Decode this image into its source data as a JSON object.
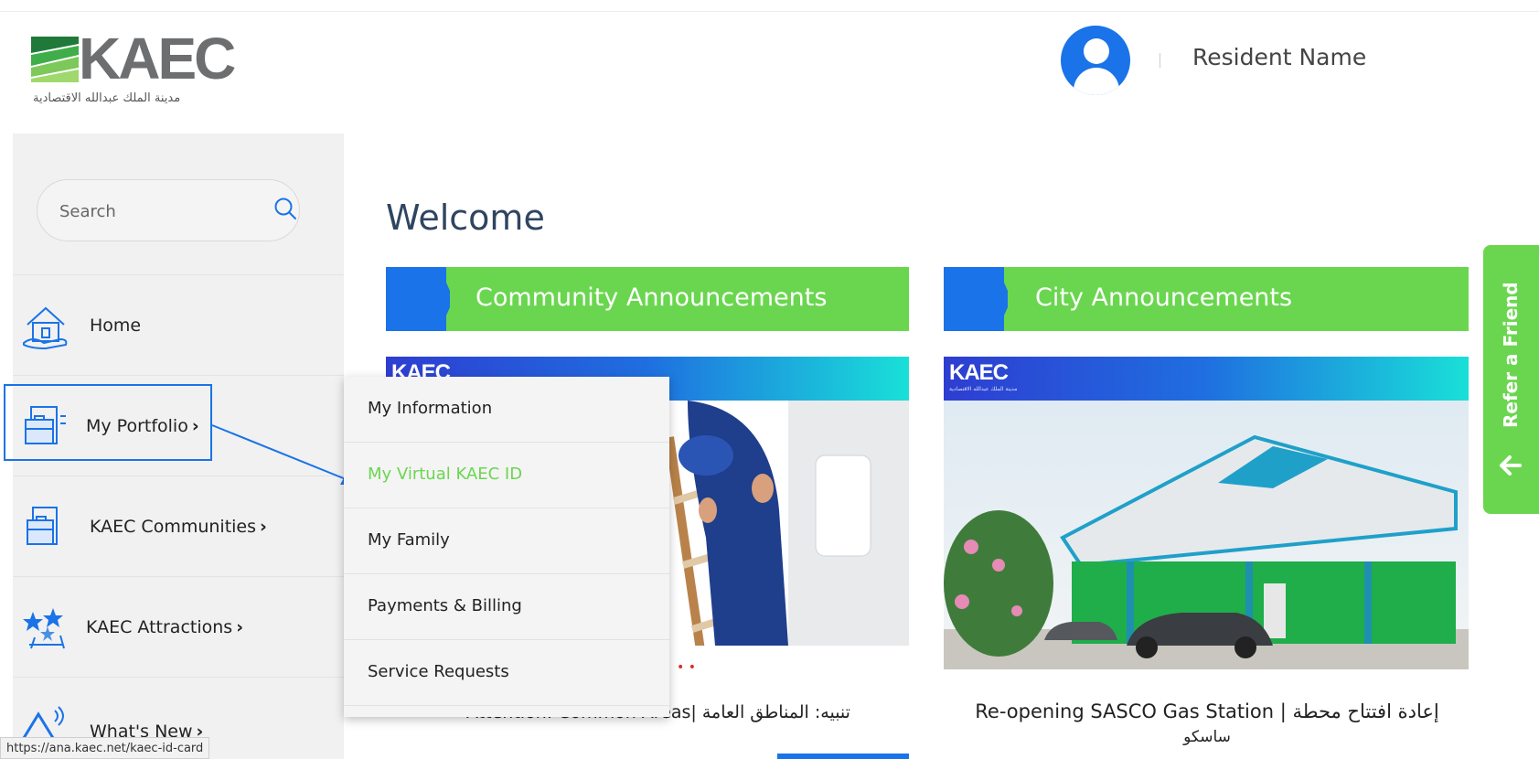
{
  "header": {
    "logo_text": "KAEC",
    "logo_arabic": "مدينة الملك عبدالله الاقتصادية",
    "resident_name": "Resident Name"
  },
  "sidebar": {
    "search_placeholder": "Search",
    "items": [
      {
        "label": "Home",
        "has_chevron": false,
        "icon": "home-icon"
      },
      {
        "label": "My Portfolio",
        "has_chevron": true,
        "icon": "portfolio-icon"
      },
      {
        "label": "KAEC Communities",
        "has_chevron": true,
        "icon": "communities-icon"
      },
      {
        "label": "KAEC Attractions",
        "has_chevron": true,
        "icon": "attractions-icon"
      },
      {
        "label": "What's New",
        "has_chevron": true,
        "icon": "whats-new-icon"
      }
    ],
    "chevron": "›"
  },
  "dropdown": {
    "items": [
      {
        "label": "My Information",
        "active": false
      },
      {
        "label": "My Virtual KAEC ID",
        "active": true
      },
      {
        "label": "My Family",
        "active": false
      },
      {
        "label": "Payments & Billing",
        "active": false
      },
      {
        "label": "Service Requests",
        "active": false
      }
    ]
  },
  "main": {
    "welcome": "Welcome",
    "community": {
      "title": "Community Announcements",
      "banner_logo": "KAEC",
      "caption": "Attention: Common Areas| تنبيه: المناطق العامة"
    },
    "city": {
      "title": "City Announcements",
      "banner_logo": "KAEC",
      "banner_sub": "مدينة الملك عبدالله الاقتصادية",
      "caption_line1": "Re-opening SASCO Gas Station | إعادة افتتاح محطة",
      "caption_line2": "ساسكو"
    }
  },
  "refer": {
    "label": "Refer a Friend"
  },
  "status_bar": {
    "url": "https://ana.kaec.net/kaec-id-card"
  },
  "colors": {
    "accent_green": "#6ad64f",
    "accent_blue": "#1a73e8",
    "text_dark": "#2f4560"
  }
}
